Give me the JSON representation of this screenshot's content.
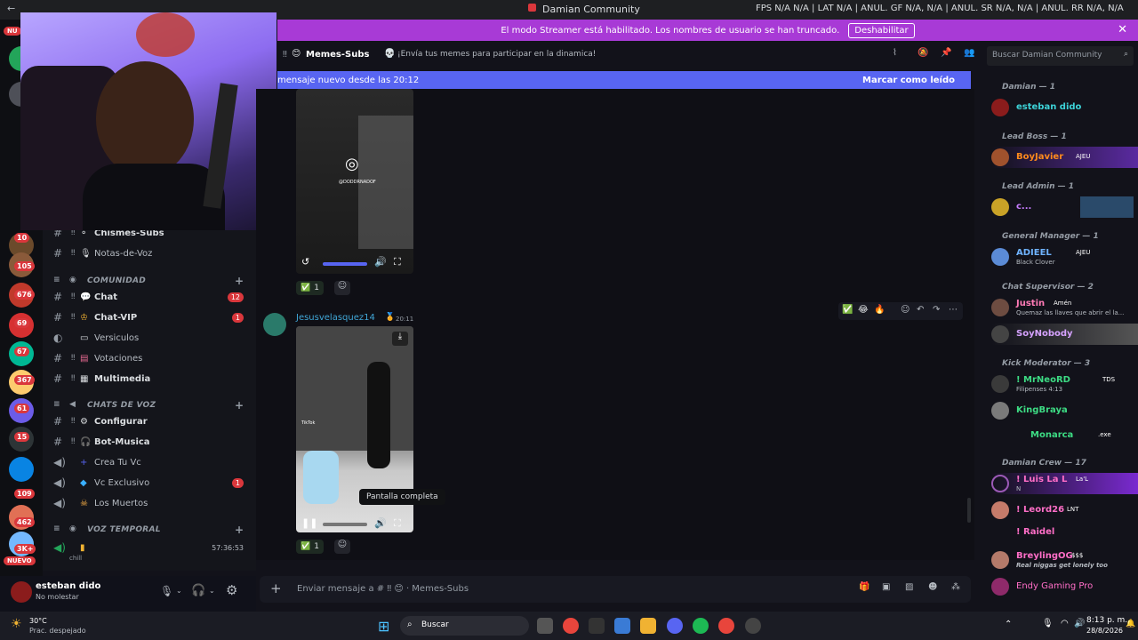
{
  "titlebar": {
    "app_title": "Damian Community",
    "perf": "FPS N/A N/A | LAT N/A | ANUL. GF N/A, N/A | ANUL. SR N/A, N/A | ANUL. RR N/A, N/A"
  },
  "banner": {
    "text": "El modo Streamer está habilitado. Los nombres de usuario se han truncado.",
    "button": "Deshabilitar"
  },
  "channel_header": {
    "name": "Memes-Subs",
    "topic": "¡Envía tus memes para participar en la dinamica!"
  },
  "search": {
    "placeholder": "Buscar Damian Community"
  },
  "newbar": {
    "text": "mensaje nuevo desde las 20:12",
    "action": "Marcar como leído"
  },
  "servers": {
    "badges": [
      "10",
      "105",
      "676",
      "69",
      "67",
      "367",
      "61",
      "15",
      "109",
      "462",
      "3K+"
    ],
    "new_label": "NUEVO",
    "top_label": "NU"
  },
  "channels": [
    {
      "name": "Chismes-Subs",
      "icon": "⚬"
    },
    {
      "name": "Notas-de-Voz",
      "icon": "🎙"
    }
  ],
  "categories": {
    "comunidad": "COMUNIDAD",
    "voz": "CHATS DE VOZ",
    "temporal": "VOZ TEMPORAL"
  },
  "comunidad_channels": [
    {
      "name": "Chat",
      "count": "12"
    },
    {
      "name": "Chat-VIP",
      "count": "1"
    },
    {
      "name": "Versiculos",
      "count": ""
    },
    {
      "name": "Votaciones",
      "count": ""
    },
    {
      "name": "Multimedia",
      "count": ""
    }
  ],
  "voice_channels": [
    {
      "name": "Configurar",
      "count": ""
    },
    {
      "name": "Bot-Musica",
      "count": ""
    },
    {
      "name": "Crea Tu Vc",
      "count": ""
    },
    {
      "name": "Vc Exclusivo",
      "count": "1"
    },
    {
      "name": "Los Muertos",
      "count": ""
    }
  ],
  "temporal": {
    "timer": "57:36:53",
    "label": "chill"
  },
  "user": {
    "name": "esteban dido",
    "status": "No molestar"
  },
  "message1": {
    "video_watermark": "@DODDRNADOF",
    "reaction_count": "1"
  },
  "message2": {
    "author": "Jesusvelasquez14",
    "time": "20:11",
    "reaction_count": "1",
    "tooltip": "Pantalla completa",
    "tiktok": "TikTok"
  },
  "composer": {
    "placeholder": "Enviar mensaje a # ‼ 😊 · Memes-Subs"
  },
  "members": {
    "roles": [
      {
        "label": "Damian — 1"
      },
      {
        "label": "Lead Boss — 1"
      },
      {
        "label": "Lead Admin — 1"
      },
      {
        "label": "General Manager — 1"
      },
      {
        "label": "Chat Supervisor — 2"
      },
      {
        "label": "Kick Moderator — 3"
      },
      {
        "label": "Damian Crew — 17"
      }
    ],
    "list": [
      {
        "name": "esteban dido",
        "status": "",
        "color": "#3dd3d8"
      },
      {
        "name": "BoyJavier",
        "status": "",
        "color": "#ff8a1c",
        "tag": "AJEU"
      },
      {
        "name": "c...",
        "status": "",
        "color": "#c77dff"
      },
      {
        "name": "ADIEEL",
        "status": "Black Clover",
        "color": "#6fb3ff",
        "tag": "AJEU"
      },
      {
        "name": "Justin",
        "status": "Quemaz las llaves que abrir el la...",
        "color": "#ff7ab6",
        "tag": "Amén"
      },
      {
        "name": "SoyNobody",
        "status": "",
        "color": "#d6a2ff"
      },
      {
        "name": "! MrNeoRD",
        "status": "Filipenses 4:13",
        "color": "#3ddc84",
        "tag": "TDS"
      },
      {
        "name": "KingBraya",
        "status": "",
        "color": "#3ddc84"
      },
      {
        "name": "Monarca",
        "status": "",
        "color": "#3ddc84",
        "tag": ".exe"
      },
      {
        "name": "! Luis La L",
        "status": "N",
        "color": "#ff6ec7",
        "tag": "La'L"
      },
      {
        "name": "! Leord26",
        "status": "",
        "color": "#ff6ec7",
        "tag": "LNT"
      },
      {
        "name": "! Raidel",
        "status": "",
        "color": "#ff6ec7"
      },
      {
        "name": "BreylingOG",
        "status": "Real niggas get lonely too",
        "color": "#ff6ec7",
        "tag": "$$$"
      },
      {
        "name": "Endy Gaming Pro",
        "status": "",
        "color": "#ff6ec7"
      }
    ]
  },
  "taskbar": {
    "weather_temp": "30°C",
    "weather_desc": "Prac. despejado",
    "search": "Buscar",
    "time": "8:13 p. m.",
    "date": "28/8/2026"
  }
}
